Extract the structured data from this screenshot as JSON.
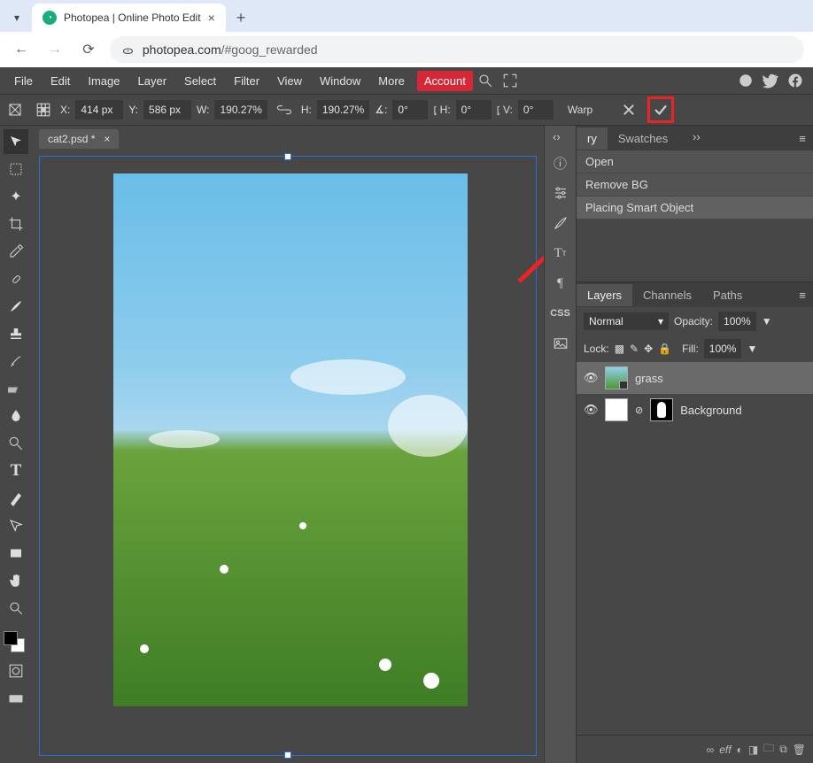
{
  "browser": {
    "tab_title": "Photopea | Online Photo Edit",
    "url_domain": "photopea.com",
    "url_path": "/#goog_rewarded"
  },
  "menus": [
    "File",
    "Edit",
    "Image",
    "Layer",
    "Select",
    "Filter",
    "View",
    "Window",
    "More"
  ],
  "account_label": "Account",
  "options_bar": {
    "x_label": "X:",
    "x_val": "414 px",
    "y_label": "Y:",
    "y_val": "586 px",
    "w_label": "W:",
    "w_val": "190.27%",
    "h_label": "H:",
    "h_val": "190.27%",
    "rot_prefix": "∡:",
    "rot_val": "0°",
    "skewh_prefix": "⦏ H:",
    "skewh_val": "0°",
    "skewv_prefix": "⦏ V:",
    "skewv_val": "0°",
    "warp": "Warp"
  },
  "doc_tab": "cat2.psd *",
  "right": {
    "tabs_top": [
      "ry",
      "Swatches"
    ],
    "history": [
      "Open",
      "Remove BG",
      "Placing Smart Object"
    ],
    "layers_tabs": [
      "Layers",
      "Channels",
      "Paths"
    ],
    "blend": "Normal",
    "opacity_label": "Opacity:",
    "opacity_val": "100%",
    "lock_label": "Lock:",
    "fill_label": "Fill:",
    "fill_val": "100%",
    "layers": [
      {
        "name": "grass",
        "active": true
      },
      {
        "name": "Background",
        "active": false
      }
    ],
    "footer": [
      "∞",
      "eff",
      "◐",
      "◨",
      "▣",
      "🗑"
    ]
  },
  "tools": [
    "move",
    "marquee",
    "wand",
    "crop",
    "eyedrop",
    "heal",
    "brush",
    "stamp",
    "history-brush",
    "eraser",
    "blur",
    "dodge",
    "type",
    "pen",
    "path-select",
    "shape",
    "hand",
    "zoom"
  ],
  "mini_col": [
    "ⓘ",
    "sliders",
    "brush",
    "T𝗍",
    "¶",
    "CSS",
    "image"
  ]
}
